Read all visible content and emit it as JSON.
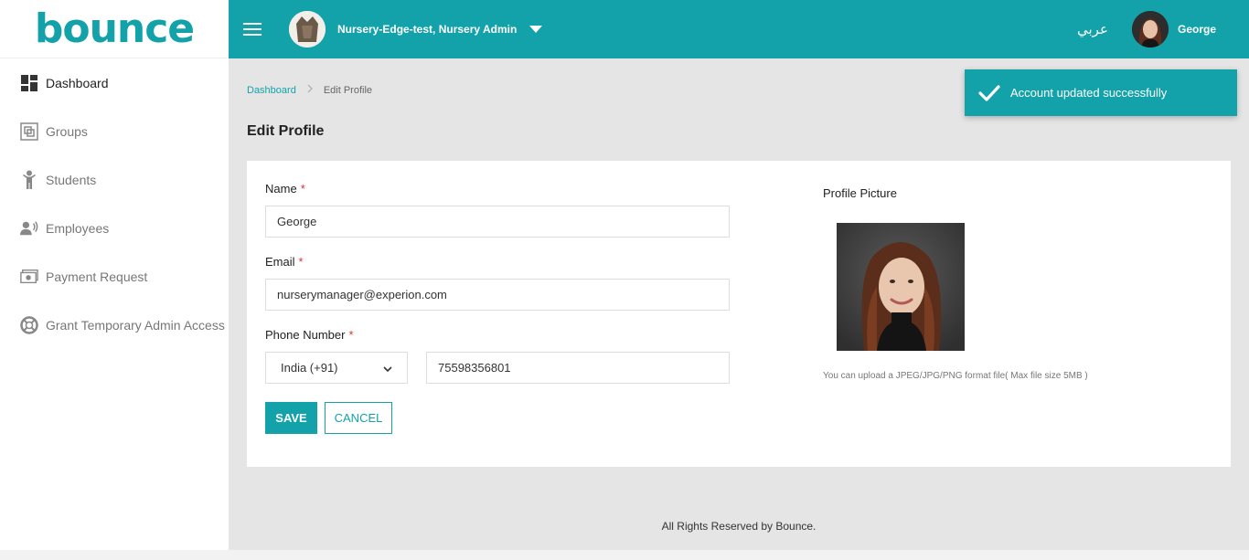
{
  "brand": {
    "logo_text": "bounce",
    "accent": "#13a2aa",
    "logo_dot_color": "#a7c83a"
  },
  "sidebar": {
    "items": [
      {
        "label": "Dashboard",
        "icon": "dashboard-icon",
        "active": true
      },
      {
        "label": "Groups",
        "icon": "groups-icon",
        "active": false
      },
      {
        "label": "Students",
        "icon": "student-icon",
        "active": false
      },
      {
        "label": "Employees",
        "icon": "employees-icon",
        "active": false
      },
      {
        "label": "Payment Request",
        "icon": "payment-icon",
        "active": false
      },
      {
        "label": "Grant Temporary Admin Access",
        "icon": "lifebuoy-icon",
        "active": false
      }
    ]
  },
  "topbar": {
    "org_name": "Nursery-Edge-test, Nursery Admin",
    "language": "عربي",
    "user_name": "George"
  },
  "breadcrumb": {
    "home": "Dashboard",
    "current": "Edit Profile"
  },
  "page": {
    "title": "Edit Profile"
  },
  "form": {
    "name_label": "Name",
    "name_value": "George",
    "email_label": "Email",
    "email_value": "nurserymanager@experion.com",
    "phone_label": "Phone Number",
    "country_code": "India (+91)",
    "phone_value": "75598356801",
    "required_mark": "*",
    "save_label": "SAVE",
    "cancel_label": "CANCEL"
  },
  "profile_picture": {
    "label": "Profile Picture",
    "help_text": "You can upload a JPEG/JPG/PNG format file( Max file size 5MB )"
  },
  "footer": {
    "text": "All Rights Reserved by Bounce."
  },
  "toast": {
    "message": "Account updated successfully",
    "icon": "check-icon"
  }
}
